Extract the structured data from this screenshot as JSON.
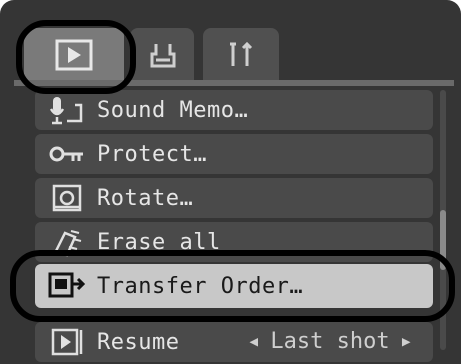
{
  "menu": {
    "tabs": [
      {
        "name": "Play",
        "icon": "play-icon"
      },
      {
        "name": "Print",
        "icon": "print-icon"
      },
      {
        "name": "Setup",
        "icon": "tools-icon"
      }
    ],
    "items": [
      {
        "label": "Sound Memo…",
        "icon": "microphone-icon"
      },
      {
        "label": "Protect…",
        "icon": "key-icon"
      },
      {
        "label": "Rotate…",
        "icon": "rotate-icon"
      },
      {
        "label": "Erase all",
        "icon": "erase-icon"
      },
      {
        "label": "Transfer Order…",
        "icon": "transfer-icon"
      },
      {
        "label": "Resume",
        "icon": "resume-icon",
        "value": "Last shot"
      }
    ],
    "selected_index": 4,
    "colors": {
      "selected_row": "#c8c8c8",
      "row": "#4a4a4a",
      "background": "#353535"
    }
  }
}
